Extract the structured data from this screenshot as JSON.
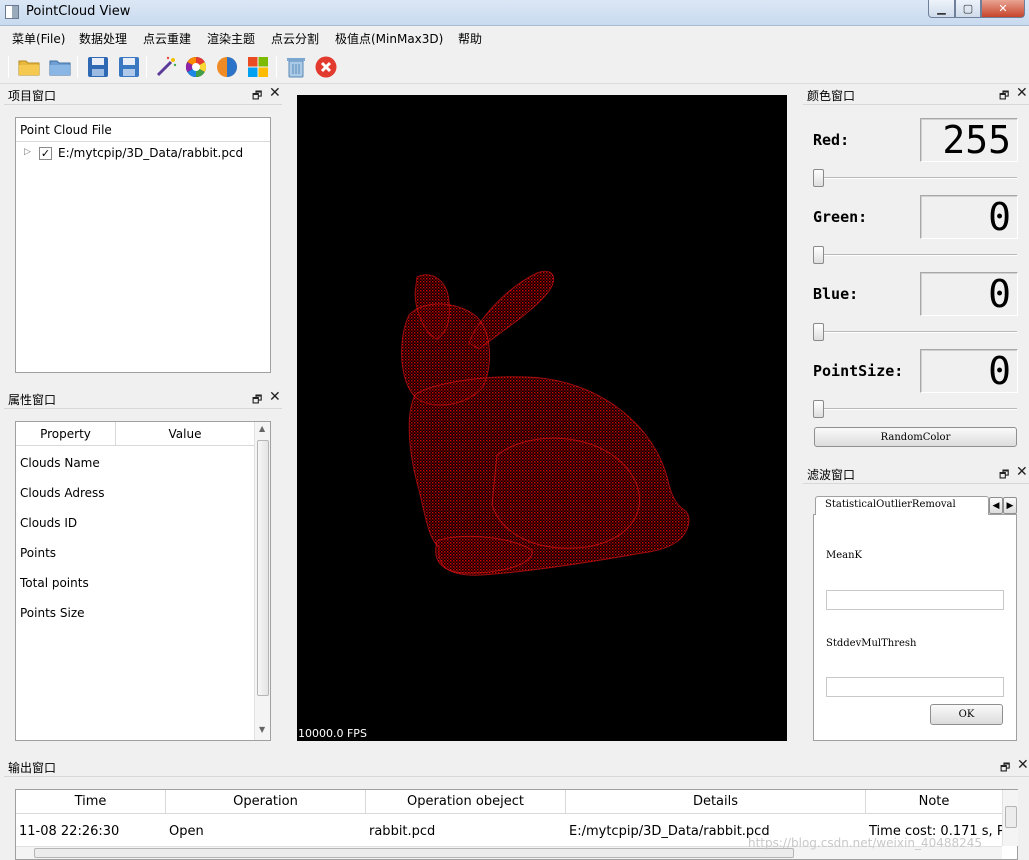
{
  "window": {
    "title": "PointCloud View",
    "min": "▁",
    "max": "▢",
    "close": "✕"
  },
  "menu": [
    "菜单(File)",
    "数据处理",
    "点云重建",
    "渲染主题",
    "点云分割",
    "极值点(MinMax3D)",
    "帮助"
  ],
  "toolbar": [
    "open-folder-icon",
    "folder-icon",
    "save-icon",
    "save-as-icon",
    "magic-wand-icon",
    "color-wheel-icon",
    "background-color-icon",
    "theme-icon",
    "delete-icon",
    "exit-icon"
  ],
  "dock": {
    "float": "🗗",
    "close": "✕"
  },
  "project_panel": {
    "title": "项目窗口",
    "tree_header": "Point Cloud File",
    "file": "E:/mytcpip/3D_Data/rabbit.pcd",
    "checked": true
  },
  "property_panel": {
    "title": "属性窗口",
    "columns": [
      "Property",
      "Value"
    ],
    "rows": [
      "Clouds Name",
      "Clouds Adress",
      "Clouds ID",
      "Points",
      "Total points",
      "Points Size"
    ]
  },
  "viewer": {
    "fps": "10000.0 FPS",
    "point_color": "#d40000"
  },
  "color_panel": {
    "title": "颜色窗口",
    "red_label": "Red:",
    "red_value": "255",
    "green_label": "Green:",
    "green_value": "0",
    "blue_label": "Blue:",
    "blue_value": "0",
    "pointsize_label": "PointSize:",
    "pointsize_value": "0",
    "random_button": "RandomColor"
  },
  "filter_panel": {
    "title": "滤波窗口",
    "tab": "StatisticalOutlierRemoval",
    "meank_label": "MeanK",
    "stddev_label": "StddevMulThresh",
    "ok_button": "OK"
  },
  "output_panel": {
    "title": "输出窗口",
    "columns": [
      "Time",
      "Operation",
      "Operation obeject",
      "Details",
      "Note"
    ],
    "rows": [
      {
        "time": "11-08 22:26:30",
        "operation": "Open",
        "object": "rabbit.pcd",
        "details": "E:/mytcpip/3D_Data/rabbit.pcd",
        "note": "Time cost: 0.171 s, Poir"
      }
    ]
  },
  "watermark": "https://blog.csdn.net/weixin_40488245"
}
